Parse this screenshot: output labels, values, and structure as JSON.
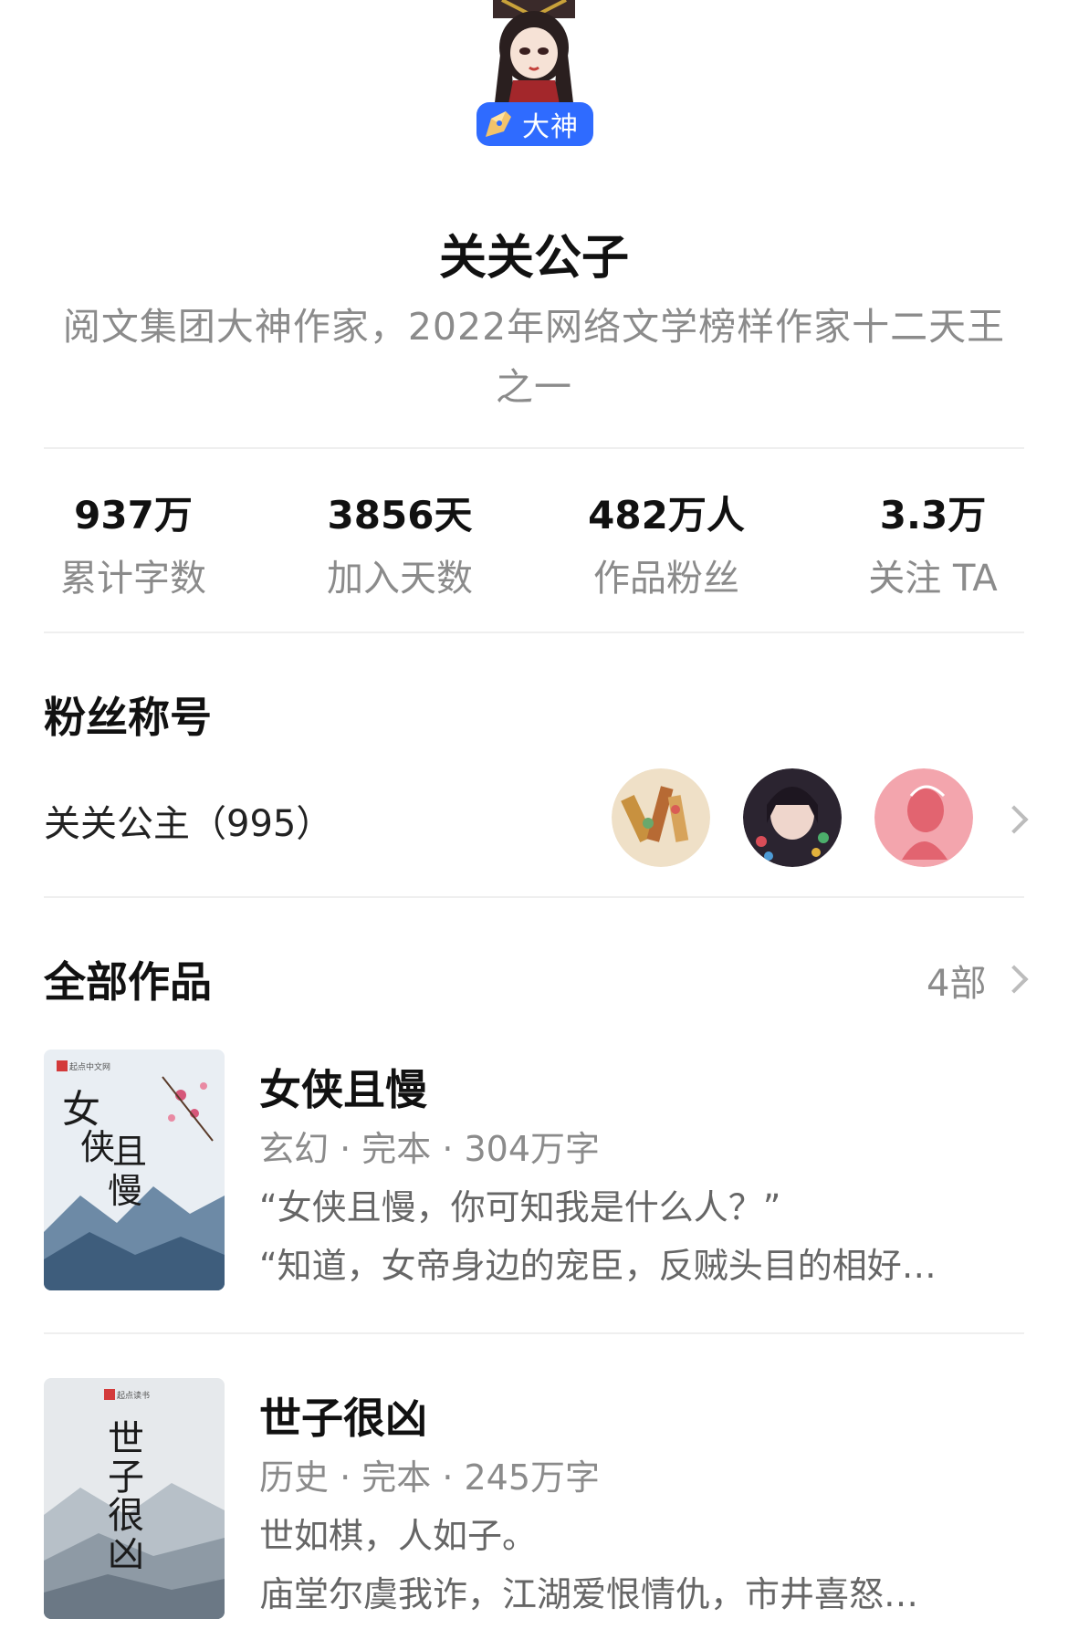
{
  "profile": {
    "badge_label": "大神",
    "name": "关关公子",
    "description": "阅文集团大神作家，2022年网络文学榜样作家十二天王之一"
  },
  "stats": [
    {
      "value": "937万",
      "label": "累计字数"
    },
    {
      "value": "3856天",
      "label": "加入天数"
    },
    {
      "value": "482万人",
      "label": "作品粉丝"
    },
    {
      "value": "3.3万",
      "label": "关注 TA"
    }
  ],
  "fan_section": {
    "title": "粉丝称号",
    "fan_title": "关关公主（995）"
  },
  "works": {
    "title": "全部作品",
    "count": "4部",
    "books": [
      {
        "title": "女侠且慢",
        "meta": "玄幻 · 完本 · 304万字",
        "line1": "“女侠且慢，你可知我是什么人？”",
        "line2": "“知道，女帝身边的宠臣，反贼头目的相好…"
      },
      {
        "title": "世子很凶",
        "meta": "历史 · 完本 · 245万字",
        "line1": "世如棋，人如子。",
        "line2": "庙堂尔虞我诈，江湖爱恨情仇，市井喜怒…"
      }
    ]
  },
  "colors": {
    "badge_blue": "#2f6bff",
    "secondary_text": "#8b8b8b",
    "divider": "#efefef"
  },
  "icons": [
    "author-avatar-icon",
    "pen-nib-icon",
    "chevron-right-icon"
  ]
}
